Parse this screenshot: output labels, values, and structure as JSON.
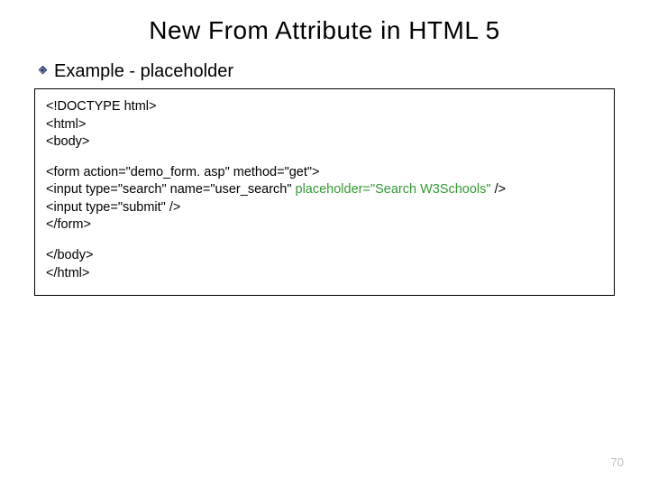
{
  "title": "New From Attribute in HTML 5",
  "bullet_label": "Example - placeholder",
  "code": {
    "p1": {
      "l1": "<!DOCTYPE html>",
      "l2": "<html>",
      "l3": "<body>"
    },
    "p2": {
      "l1": "<form action=\"demo_form. asp\" method=\"get\">",
      "l2a": "<input type=\"search\" name=\"user_search\" ",
      "l2b": "placeholder=\"Search W3Schools\"",
      "l2c": " />",
      "l3": "<input type=\"submit\" />",
      "l4": "</form>"
    },
    "p3": {
      "l1": "</body>",
      "l2": "</html>"
    }
  },
  "page_number": "70"
}
